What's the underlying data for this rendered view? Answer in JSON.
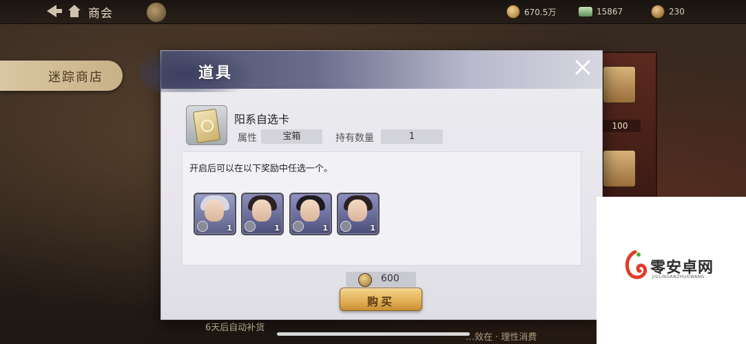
{
  "header": {
    "title": "商会",
    "currencies": [
      {
        "icon": "coin-icon",
        "value": "670.5万"
      },
      {
        "icon": "jade-icon",
        "value": "15867"
      },
      {
        "icon": "gem-icon",
        "value": "230"
      }
    ]
  },
  "sidebar": {
    "shop_tab": "迷踪商店"
  },
  "shelf": {
    "price": "100"
  },
  "footer": {
    "restock_text": "6天后自动补货",
    "right_text": "…效在 · 理性消费"
  },
  "dialog": {
    "title": "道具",
    "item": {
      "name": "阳系自选卡",
      "attr_label": "属性",
      "attr_value": "宝箱",
      "owned_label": "持有数量",
      "owned_value": "1"
    },
    "description": "开启后可以在以下奖励中任选一个。",
    "rewards": [
      {
        "name": "reward-1",
        "count": "1",
        "hair_color": "#d8d8e4"
      },
      {
        "name": "reward-2",
        "count": "1",
        "hair_color": "#2c2222"
      },
      {
        "name": "reward-3",
        "count": "1",
        "hair_color": "#1f1a22"
      },
      {
        "name": "reward-4",
        "count": "1",
        "hair_color": "#2a2220"
      }
    ],
    "price": "600",
    "buy_label": "购买"
  },
  "watermark": {
    "brand": "零安卓网",
    "sub": "JIULINGANZHUOWANG"
  },
  "colors": {
    "dialog_header": "#4c4e6e",
    "buy_button": "#e3b259",
    "item_name": "#222222"
  }
}
